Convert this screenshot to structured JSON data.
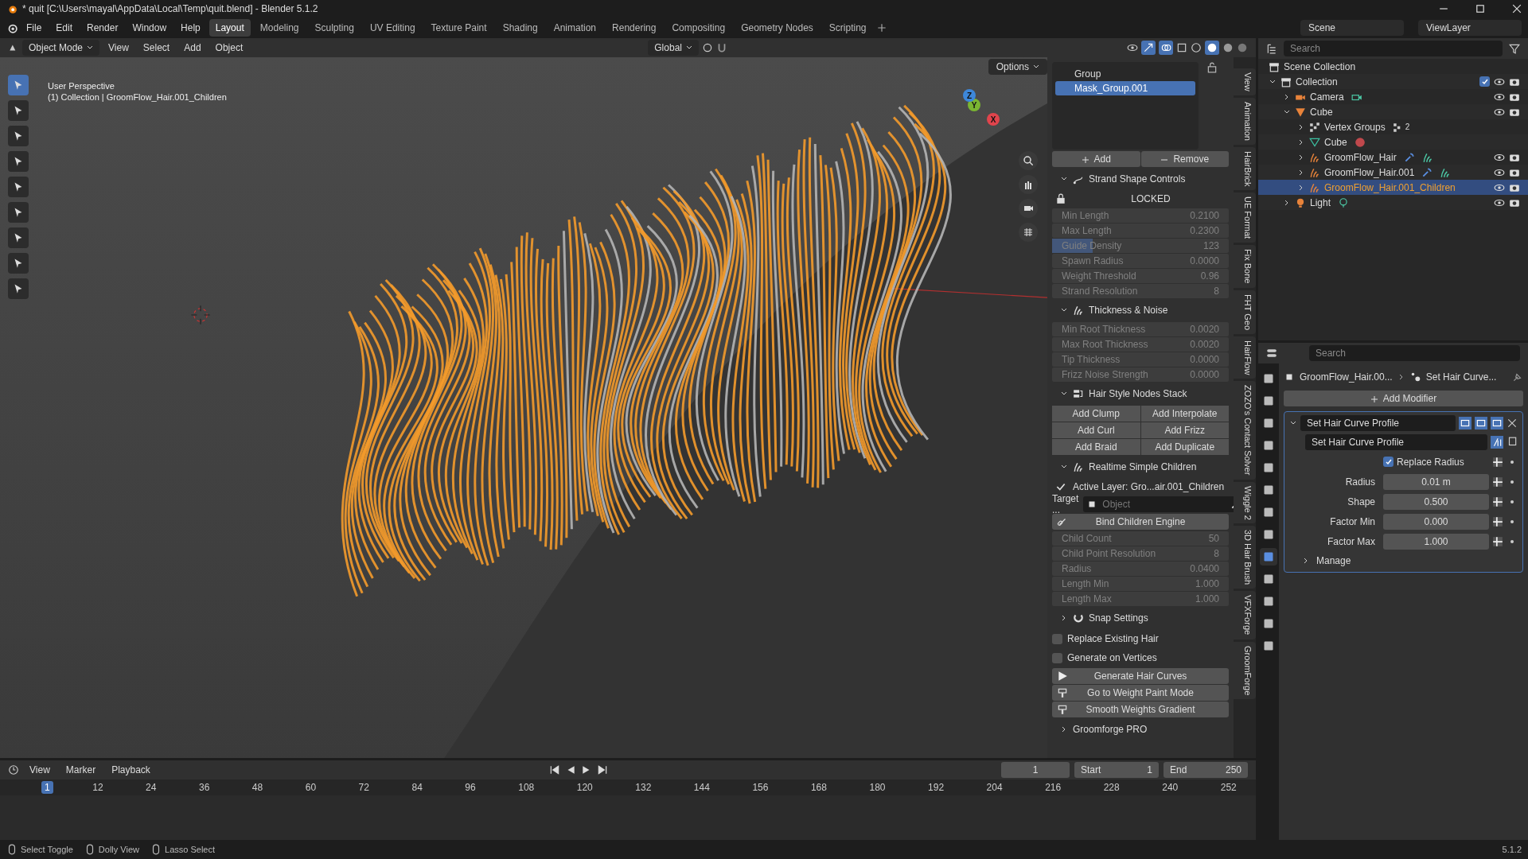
{
  "title_bar": {
    "title": "* quit [C:\\Users\\mayal\\AppData\\Local\\Temp\\quit.blend] - Blender 5.1.2"
  },
  "menu": [
    "File",
    "Edit",
    "Render",
    "Window",
    "Help"
  ],
  "workspaces": [
    {
      "label": "Layout",
      "selected": true
    },
    {
      "label": "Modeling",
      "selected": false
    },
    {
      "label": "Sculpting",
      "selected": false
    },
    {
      "label": "UV Editing",
      "selected": false
    },
    {
      "label": "Texture Paint",
      "selected": false
    },
    {
      "label": "Shading",
      "selected": false
    },
    {
      "label": "Animation",
      "selected": false
    },
    {
      "label": "Rendering",
      "selected": false
    },
    {
      "label": "Compositing",
      "selected": false
    },
    {
      "label": "Geometry Nodes",
      "selected": false
    },
    {
      "label": "Scripting",
      "selected": false
    }
  ],
  "scene": "Scene",
  "view_layer": "ViewLayer",
  "viewport": {
    "mode": "Object Mode",
    "menus": [
      "View",
      "Select",
      "Add",
      "Object"
    ],
    "orientation": "Global",
    "options": "Options",
    "overlay_text": [
      "User Perspective",
      "(1) Collection | GroomFlow_Hair.001_Children"
    ],
    "tools": [
      {
        "selected": true
      },
      {
        "selected": false
      },
      {
        "selected": false
      },
      {
        "selected": false
      },
      {
        "selected": false
      },
      {
        "selected": false
      },
      {
        "selected": false
      },
      {
        "selected": false
      },
      {
        "selected": false
      }
    ],
    "gizmo": [
      {
        "label": "X",
        "color": "#e0444c"
      },
      {
        "label": "Y",
        "color": "#7ab532"
      },
      {
        "label": "Z",
        "color": "#3d87d9"
      }
    ]
  },
  "sidebar": {
    "vertex_groups": [
      {
        "label": "Group",
        "selected": false
      },
      {
        "label": "Mask_Group.001",
        "selected": true
      }
    ],
    "add": "Add",
    "remove": "Remove",
    "panels": [
      {
        "kind": "section",
        "label": "Strand Shape Controls",
        "expanded": true
      },
      {
        "kind": "note",
        "label": "LOCKED",
        "locked": true
      },
      {
        "kind": "fields",
        "disabled": true,
        "fields": [
          {
            "label": "Min Length",
            "value": "0.2100"
          },
          {
            "label": "Max Length",
            "value": "0.2300"
          },
          {
            "label": "Guide Density",
            "value": "123",
            "level": 0.23
          },
          {
            "label": "Spawn Radius",
            "value": "0.0000"
          },
          {
            "label": "Weight Threshold",
            "value": "0.96"
          },
          {
            "label": "Strand Resolution",
            "value": "8"
          }
        ]
      },
      {
        "kind": "section",
        "label": "Thickness & Noise",
        "expanded": true
      },
      {
        "kind": "fields",
        "disabled": true,
        "fields": [
          {
            "label": "Min Root Thickness",
            "value": "0.0020"
          },
          {
            "label": "Max Root Thickness",
            "value": "0.0020"
          },
          {
            "label": "Tip Thickness",
            "value": "0.0000"
          },
          {
            "label": "Frizz Noise Strength",
            "value": "0.0000"
          }
        ]
      },
      {
        "kind": "section",
        "label": "Hair Style Nodes Stack",
        "expanded": true
      },
      {
        "kind": "button_grid",
        "buttons": [
          "Add Clump",
          "Add Interpolate",
          "Add Curl",
          "Add Frizz",
          "Add Braid",
          "Add Duplicate"
        ]
      },
      {
        "kind": "section",
        "label": "Realtime Simple Children",
        "expanded": true
      },
      {
        "kind": "check_line",
        "label": "Active Layer: Gro...air.001_Children",
        "checked": true
      },
      {
        "kind": "object_field",
        "label": "Target ...",
        "placeholder": "Object"
      },
      {
        "kind": "button",
        "label": "Bind Children Engine"
      },
      {
        "kind": "fields",
        "disabled": true,
        "fields": [
          {
            "label": "Child Count",
            "value": "50"
          },
          {
            "label": "Child Point Resolution",
            "value": "8"
          },
          {
            "label": "Radius",
            "value": "0.0400"
          },
          {
            "label": "Length Min",
            "value": "1.000"
          },
          {
            "label": "Length Max",
            "value": "1.000"
          }
        ]
      },
      {
        "kind": "section",
        "label": "Snap Settings",
        "expanded": false
      },
      {
        "kind": "checkbox",
        "label": "Replace Existing Hair",
        "checked": false
      },
      {
        "kind": "checkbox",
        "label": "Generate on Vertices",
        "checked": false
      },
      {
        "kind": "actions",
        "buttons": [
          "Generate Hair Curves",
          "Go to Weight Paint Mode",
          "Smooth Weights Gradient"
        ]
      },
      {
        "kind": "section",
        "label": "Groomforge PRO",
        "expanded": false
      }
    ]
  },
  "sidebar_tabs": [
    "View",
    "Animation",
    "HairBrick",
    "UE Format",
    "Fix Bone",
    "FHT Geo",
    "HairFlow",
    "ZOZO's Contact Solver",
    "Wiggle 2",
    "3D Hair Brush",
    "VFXForge",
    "GroomForge"
  ],
  "outliner": {
    "search": {
      "placeholder": "Search"
    },
    "tree": [
      {
        "label": "Scene Collection",
        "kind": "collection",
        "selected": false
      },
      {
        "label": "Collection",
        "kind": "collection",
        "expanded": true,
        "checked": true,
        "toggles": true,
        "selected": false,
        "children": [
          {
            "label": "Camera",
            "kind": "camera",
            "expanded": false,
            "toggles": true,
            "selected": false,
            "data_icons": [
              {
                "kind": "camera"
              }
            ]
          },
          {
            "label": "Cube",
            "kind": "object",
            "expanded": true,
            "toggles": true,
            "selected": false,
            "children": [
              {
                "label": "Vertex Groups",
                "kind": "vertexgroups",
                "expanded": false,
                "selected": false,
                "data_icons": [
                  {
                    "kind": "vertexgroups"
                  }
                ],
                "count": "2"
              },
              {
                "label": "Cube",
                "kind": "mesh",
                "expanded": false,
                "selected": false,
                "data_icons": [
                  {
                    "kind": "material"
                  }
                ]
              },
              {
                "label": "GroomFlow_Hair",
                "kind": "curves",
                "expanded": false,
                "toggles": true,
                "selected": false,
                "data_icons": [
                  {
                    "kind": "modifier"
                  },
                  {
                    "kind": "curves"
                  }
                ]
              },
              {
                "label": "GroomFlow_Hair.001",
                "kind": "curves",
                "expanded": false,
                "toggles": true,
                "selected": false,
                "data_icons": [
                  {
                    "kind": "modifier"
                  },
                  {
                    "kind": "curves"
                  }
                ]
              },
              {
                "label": "GroomFlow_Hair.001_Children",
                "kind": "curves",
                "expanded": false,
                "toggles": true,
                "selected": true
              }
            ]
          },
          {
            "label": "Light",
            "kind": "light",
            "expanded": false,
            "toggles": true,
            "selected": false,
            "data_icons": [
              {
                "kind": "light"
              }
            ]
          }
        ]
      }
    ]
  },
  "properties": {
    "search": {
      "placeholder": "Search"
    },
    "tabs": [
      {
        "selected": false
      },
      {
        "selected": false
      },
      {
        "selected": false
      },
      {
        "selected": false
      },
      {
        "selected": false
      },
      {
        "selected": false
      },
      {
        "selected": false
      },
      {
        "selected": false
      },
      {
        "selected": true
      },
      {
        "selected": false
      },
      {
        "selected": false
      },
      {
        "selected": false
      },
      {
        "selected": false
      }
    ],
    "breadcrumb": [
      "GroomFlow_Hair.00...",
      "Set Hair Curve..."
    ],
    "add_modifier": "Add Modifier",
    "modifier": {
      "name": "Set Hair Curve Profile",
      "expanded": true,
      "toggles": [
        {
          "on": true
        },
        {
          "on": true
        },
        {
          "on": true
        }
      ],
      "node_group": "Set Hair Curve Profile",
      "inputs": [
        {
          "kind": "checkbox",
          "label": "Replace Radius",
          "checked": true
        },
        {
          "kind": "number",
          "label": "Radius",
          "value": "0.01 m"
        },
        {
          "kind": "number",
          "label": "Shape",
          "value": "0.500"
        },
        {
          "kind": "number",
          "label": "Factor Min",
          "value": "0.000"
        },
        {
          "kind": "number",
          "label": "Factor Max",
          "value": "1.000"
        }
      ],
      "manage": {
        "label": "Manage",
        "expanded": false
      }
    }
  },
  "timeline": {
    "menus": [
      "View",
      "Marker",
      "Playback"
    ],
    "current_frame": "1",
    "start_label": "Start",
    "start": "1",
    "end_label": "End",
    "end": "250",
    "ruler": [
      {
        "label": "1",
        "selected": true
      },
      {
        "label": "12",
        "selected": false
      },
      {
        "label": "24",
        "selected": false
      },
      {
        "label": "36",
        "selected": false
      },
      {
        "label": "48",
        "selected": false
      },
      {
        "label": "60",
        "selected": false
      },
      {
        "label": "72",
        "selected": false
      },
      {
        "label": "84",
        "selected": false
      },
      {
        "label": "96",
        "selected": false
      },
      {
        "label": "108",
        "selected": false
      },
      {
        "label": "120",
        "selected": false
      },
      {
        "label": "132",
        "selected": false
      },
      {
        "label": "144",
        "selected": false
      },
      {
        "label": "156",
        "selected": false
      },
      {
        "label": "168",
        "selected": false
      },
      {
        "label": "180",
        "selected": false
      },
      {
        "label": "192",
        "selected": false
      },
      {
        "label": "204",
        "selected": false
      },
      {
        "label": "216",
        "selected": false
      },
      {
        "label": "228",
        "selected": false
      },
      {
        "label": "240",
        "selected": false
      },
      {
        "label": "252",
        "selected": false
      }
    ]
  },
  "status_bar": {
    "hints": [
      "Select Toggle",
      "Dolly View",
      "Lasso Select"
    ],
    "version": "5.1.2"
  }
}
